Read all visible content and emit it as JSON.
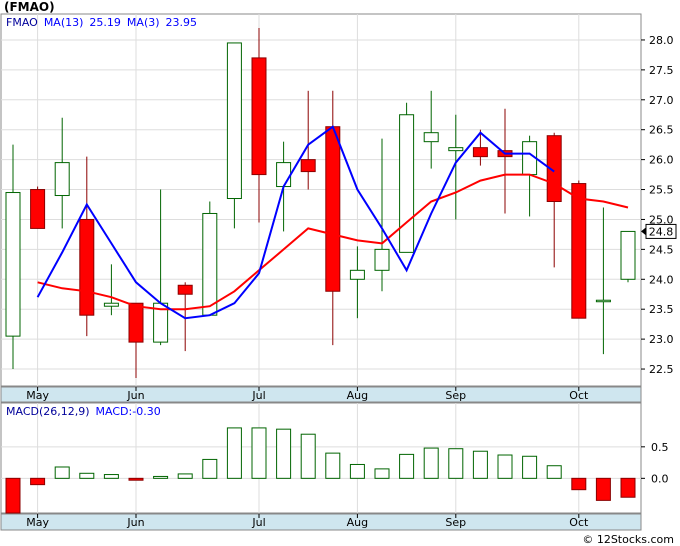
{
  "title": "(FMAO)",
  "watermark": "© 12Stocks.com",
  "price_panel": {
    "legend": [
      {
        "text": "FMAO",
        "color": "#00009a"
      },
      {
        "text": "MA(13)",
        "color": "#0000ff"
      },
      {
        "text": "25.19",
        "color": "#0000ff"
      },
      {
        "text": "MA(3)",
        "color": "#0000ff"
      },
      {
        "text": "23.95",
        "color": "#0000ff"
      }
    ],
    "last_price_label": "24.8"
  },
  "macd_panel": {
    "legend": [
      {
        "text": "MACD(26,12,9)",
        "color": "#00009a"
      },
      {
        "text": "MACD:-0.30",
        "color": "#0000ff"
      }
    ]
  },
  "colors": {
    "up": "#006400",
    "down": "#ff0000",
    "ma13": "#ff0000",
    "ma3": "#0000ff",
    "axis_band": "#cfe6ef",
    "grid": "#dddddd"
  },
  "chart_data": [
    {
      "type": "candlestick",
      "ylim": [
        22.25,
        28.3
      ],
      "yticks": [
        22.5,
        23.0,
        23.5,
        24.0,
        24.5,
        25.0,
        25.5,
        26.0,
        26.5,
        27.0,
        27.5,
        28.0
      ],
      "ytick_labels": [
        "22.5",
        "23.0",
        "23.5",
        "24.0",
        "24.5",
        "25.0",
        "25.5",
        "26.0",
        "26.5",
        "27.0",
        "27.5",
        "28.0"
      ],
      "x_labels": [
        "May",
        "Jun",
        "Jul",
        "Aug",
        "Sep",
        "Oct"
      ],
      "x_label_bar_index": [
        1,
        5,
        10,
        14,
        18,
        23
      ],
      "candles": [
        {
          "open": 23.05,
          "close": 25.45,
          "high": 26.25,
          "low": 22.5
        },
        {
          "open": 25.5,
          "close": 24.85,
          "high": 25.55,
          "low": 24.85
        },
        {
          "open": 25.4,
          "close": 25.95,
          "high": 26.7,
          "low": 24.85
        },
        {
          "open": 25.0,
          "close": 23.4,
          "high": 26.05,
          "low": 23.05
        },
        {
          "open": 23.55,
          "close": 23.6,
          "high": 24.25,
          "low": 23.4
        },
        {
          "open": 23.6,
          "close": 22.95,
          "high": 23.6,
          "low": 22.35
        },
        {
          "open": 22.95,
          "close": 23.6,
          "high": 25.5,
          "low": 22.9
        },
        {
          "open": 23.9,
          "close": 23.75,
          "high": 23.95,
          "low": 22.8
        },
        {
          "open": 23.4,
          "close": 25.1,
          "high": 25.3,
          "low": 23.4
        },
        {
          "open": 25.35,
          "close": 27.95,
          "high": 27.95,
          "low": 24.85
        },
        {
          "open": 27.7,
          "close": 25.75,
          "high": 28.2,
          "low": 24.95
        },
        {
          "open": 25.55,
          "close": 25.95,
          "high": 26.3,
          "low": 24.8
        },
        {
          "open": 26.0,
          "close": 25.8,
          "high": 27.15,
          "low": 25.5
        },
        {
          "open": 26.55,
          "close": 23.8,
          "high": 27.15,
          "low": 22.9
        },
        {
          "open": 24.0,
          "close": 24.15,
          "high": 24.55,
          "low": 23.35
        },
        {
          "open": 24.15,
          "close": 24.5,
          "high": 26.35,
          "low": 23.8
        },
        {
          "open": 24.45,
          "close": 26.75,
          "high": 26.95,
          "low": 24.45
        },
        {
          "open": 26.3,
          "close": 26.45,
          "high": 27.15,
          "low": 25.85
        },
        {
          "open": 26.15,
          "close": 26.2,
          "high": 26.75,
          "low": 25.0
        },
        {
          "open": 26.2,
          "close": 26.05,
          "high": 26.5,
          "low": 25.9
        },
        {
          "open": 26.15,
          "close": 26.05,
          "high": 26.85,
          "low": 25.1
        },
        {
          "open": 25.75,
          "close": 26.3,
          "high": 26.4,
          "low": 25.05
        },
        {
          "open": 26.4,
          "close": 25.3,
          "high": 26.45,
          "low": 24.2
        },
        {
          "open": 25.6,
          "close": 23.35,
          "high": 25.65,
          "low": 23.35
        },
        {
          "open": 23.65,
          "close": 23.65,
          "high": 25.2,
          "low": 22.75
        },
        {
          "open": 24.0,
          "close": 24.8,
          "high": 24.8,
          "low": 23.95
        }
      ],
      "series": [
        {
          "name": "MA(13)",
          "values": [
            null,
            23.95,
            23.85,
            23.8,
            23.7,
            23.55,
            23.5,
            23.5,
            23.55,
            23.8,
            24.15,
            24.5,
            24.85,
            24.75,
            24.65,
            24.6,
            24.95,
            25.3,
            25.45,
            25.65,
            25.75,
            25.75,
            25.6,
            25.35,
            25.3,
            25.2
          ]
        },
        {
          "name": "MA(3)",
          "values": [
            null,
            23.7,
            24.45,
            25.25,
            24.6,
            23.95,
            23.6,
            23.35,
            23.4,
            23.6,
            24.1,
            25.55,
            26.25,
            26.55,
            25.5,
            24.85,
            24.15,
            25.1,
            25.95,
            26.45,
            26.1,
            26.1,
            25.8,
            null,
            null,
            null
          ]
        }
      ]
    },
    {
      "type": "bar",
      "title": "MACD(26,12,9)",
      "ylim": [
        -0.55,
        1.1
      ],
      "yticks": [
        0.0,
        0.5
      ],
      "ytick_labels": [
        "0.0",
        "0.5"
      ],
      "x_labels": [
        "May",
        "Jun",
        "Jul",
        "Aug",
        "Sep",
        "Oct"
      ],
      "values": [
        -0.55,
        -0.1,
        0.18,
        0.08,
        0.06,
        -0.03,
        0.03,
        0.07,
        0.3,
        0.8,
        0.8,
        0.78,
        0.7,
        0.4,
        0.22,
        0.15,
        0.38,
        0.48,
        0.47,
        0.43,
        0.37,
        0.35,
        0.2,
        -0.18,
        -0.35,
        -0.3
      ]
    }
  ]
}
